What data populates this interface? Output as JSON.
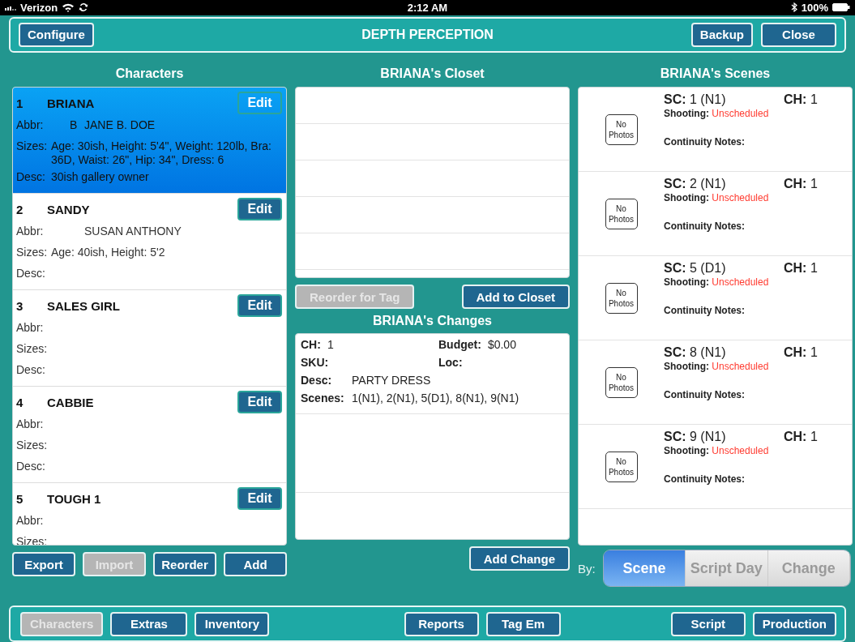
{
  "status_bar": {
    "carrier": "Verizon",
    "time": "2:12 AM",
    "battery": "100%"
  },
  "header": {
    "left_button": "Configure",
    "title": "DEPTH PERCEPTION",
    "right_buttons": [
      "Backup",
      "Close"
    ]
  },
  "characters": {
    "heading": "Characters",
    "items": [
      {
        "number": "1",
        "name": "BRIANA",
        "selected": true,
        "edit": "Edit",
        "fields": [
          {
            "kind": "abbr",
            "label": "Abbr:",
            "code": "B",
            "value": "JANE B. DOE"
          },
          {
            "kind": "text",
            "label": "Sizes:",
            "value": "Age: 30ish, Height: 5'4\", Weight: 120lb, Bra: 36D, Waist: 26\", Hip: 34\", Dress: 6"
          },
          {
            "kind": "text",
            "label": "Desc:",
            "value": "30ish gallery owner"
          }
        ]
      },
      {
        "number": "2",
        "name": "SANDY",
        "selected": false,
        "edit": "Edit",
        "fields": [
          {
            "kind": "abbr",
            "label": "Abbr:",
            "value": "SUSAN ANTHONY"
          },
          {
            "kind": "text",
            "label": "Sizes:",
            "value": "Age: 40ish, Height: 5'2"
          },
          {
            "kind": "text",
            "label": "Desc:"
          }
        ]
      },
      {
        "number": "3",
        "name": "SALES GIRL",
        "selected": false,
        "edit": "Edit",
        "fields": [
          {
            "kind": "abbr",
            "label": "Abbr:"
          },
          {
            "kind": "text",
            "label": "Sizes:"
          },
          {
            "kind": "text",
            "label": "Desc:"
          }
        ]
      },
      {
        "number": "4",
        "name": "CABBIE",
        "selected": false,
        "edit": "Edit",
        "fields": [
          {
            "kind": "abbr",
            "label": "Abbr:"
          },
          {
            "kind": "text",
            "label": "Sizes:"
          },
          {
            "kind": "text",
            "label": "Desc:"
          }
        ]
      },
      {
        "number": "5",
        "name": "TOUGH 1",
        "selected": false,
        "edit": "Edit",
        "fields": [
          {
            "kind": "abbr",
            "label": "Abbr:"
          },
          {
            "kind": "text",
            "label": "Sizes:"
          }
        ]
      }
    ],
    "buttons": [
      {
        "label": "Export",
        "disabled": false
      },
      {
        "label": "Import",
        "disabled": true
      },
      {
        "label": "Reorder",
        "disabled": false
      },
      {
        "label": "Add",
        "disabled": false
      }
    ]
  },
  "closet": {
    "heading": "BRIANA's Closet",
    "buttons": [
      {
        "label": "Reorder for Tag",
        "disabled": true
      },
      {
        "label": "Add to Closet",
        "disabled": false
      }
    ]
  },
  "changes": {
    "heading": "BRIANA's Changes",
    "rows": [
      [
        {
          "label": "CH:",
          "value": "1"
        },
        {
          "label": "Budget:",
          "value": "$0.00"
        }
      ],
      [
        {
          "label": "SKU:"
        },
        {
          "label": "Loc:"
        }
      ],
      [
        {
          "label": "Desc:",
          "value": "PARTY DRESS"
        }
      ],
      [
        {
          "label": "Scenes:",
          "value": "1(N1), 2(N1), 5(D1), 8(N1), 9(N1)"
        }
      ]
    ],
    "button": "Add Change"
  },
  "scenes": {
    "heading": "BRIANA's Scenes",
    "items": [
      {
        "photo": "No Photos",
        "sc_label": "SC:",
        "sc": "1 (N1)",
        "ch_label": "CH:",
        "ch": "1",
        "shooting_label": "Shooting:",
        "shooting": "Unscheduled",
        "notes_label": "Continuity Notes:"
      },
      {
        "photo": "No Photos",
        "sc_label": "SC:",
        "sc": "2 (N1)",
        "ch_label": "CH:",
        "ch": "1",
        "shooting_label": "Shooting:",
        "shooting": "Unscheduled",
        "notes_label": "Continuity Notes:"
      },
      {
        "photo": "No Photos",
        "sc_label": "SC:",
        "sc": "5 (D1)",
        "ch_label": "CH:",
        "ch": "1",
        "shooting_label": "Shooting:",
        "shooting": "Unscheduled",
        "notes_label": "Continuity Notes:"
      },
      {
        "photo": "No Photos",
        "sc_label": "SC:",
        "sc": "8 (N1)",
        "ch_label": "CH:",
        "ch": "1",
        "shooting_label": "Shooting:",
        "shooting": "Unscheduled",
        "notes_label": "Continuity Notes:"
      },
      {
        "photo": "No Photos",
        "sc_label": "SC:",
        "sc": "9 (N1)",
        "ch_label": "CH:",
        "ch": "1",
        "shooting_label": "Shooting:",
        "shooting": "Unscheduled",
        "notes_label": "Continuity Notes:"
      }
    ],
    "by_label": "By:",
    "segments": [
      {
        "label": "Scene",
        "selected": true
      },
      {
        "label": "Script Day",
        "selected": false
      },
      {
        "label": "Change",
        "selected": false
      }
    ]
  },
  "bottom_nav": {
    "groups": [
      [
        {
          "label": "Characters",
          "selected": true
        },
        {
          "label": "Extras",
          "selected": false
        },
        {
          "label": "Inventory",
          "selected": false
        }
      ],
      [
        {
          "label": "Reports",
          "selected": false
        },
        {
          "label": "Tag Em",
          "selected": false
        }
      ],
      [
        {
          "label": "Script",
          "selected": false
        },
        {
          "label": "Production",
          "selected": false
        }
      ]
    ]
  }
}
